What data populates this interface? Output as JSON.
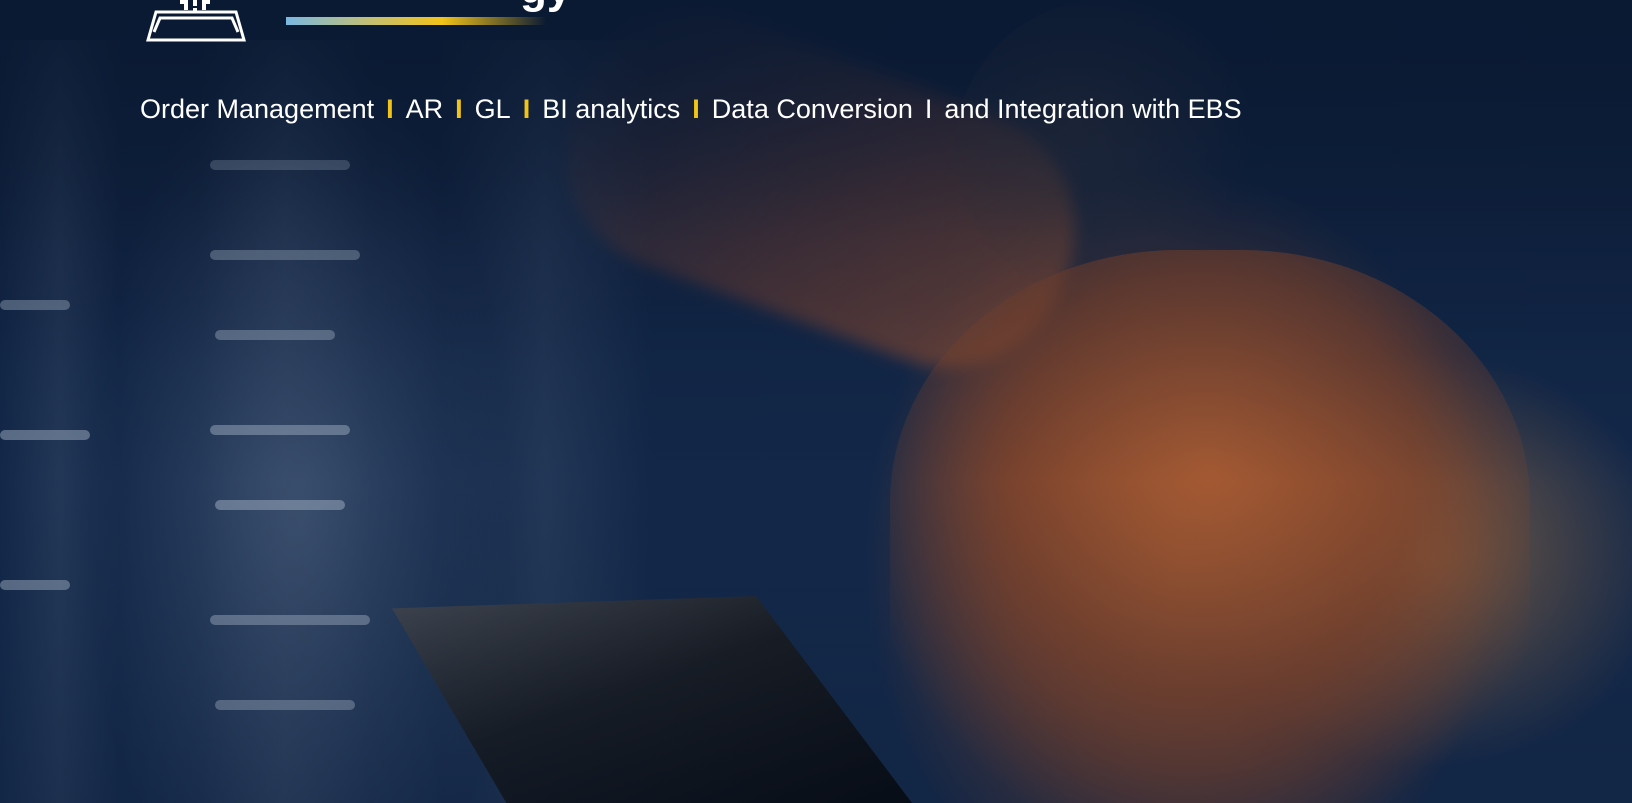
{
  "hero": {
    "title_fragment": "gy",
    "tagline_items": [
      "Order Management",
      "AR",
      "GL",
      "BI analytics",
      "Data Conversion",
      "and Integration with EBS"
    ],
    "separators": [
      "I",
      "I",
      "I",
      "I",
      "I"
    ]
  },
  "colors": {
    "background": "#0b1a33",
    "accent_yellow": "#f2c318",
    "accent_blue": "#7ab8e0",
    "text": "#ffffff"
  },
  "icons": {
    "logo": "building-columns-icon"
  }
}
